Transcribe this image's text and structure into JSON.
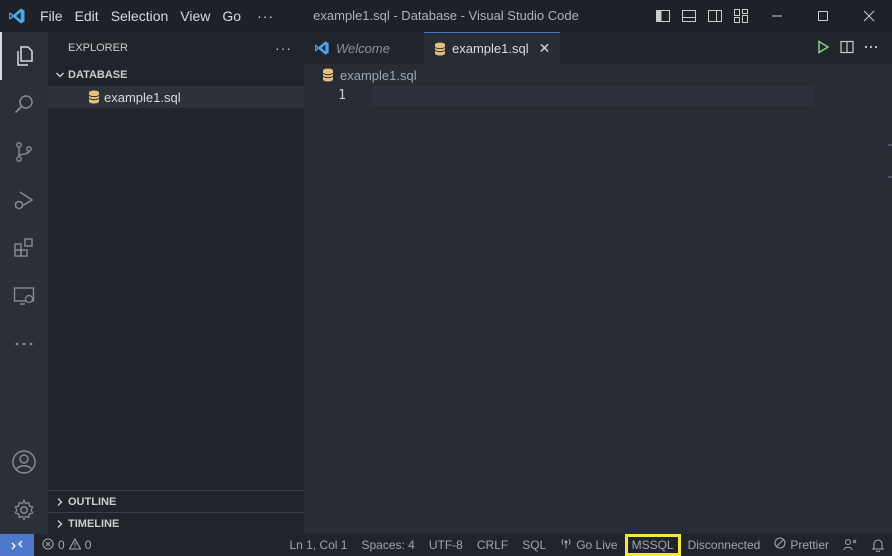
{
  "titlebar": {
    "menu": [
      "File",
      "Edit",
      "Selection",
      "View",
      "Go"
    ],
    "more": "···",
    "title": "example1.sql - Database - Visual Studio Code"
  },
  "sidebar": {
    "header": "EXPLORER",
    "more": "···",
    "folder": "DATABASE",
    "files": [
      {
        "name": "example1.sql",
        "icon": "database-icon"
      }
    ],
    "outline": "OUTLINE",
    "timeline": "TIMELINE"
  },
  "tabs": [
    {
      "label": "Welcome",
      "icon": "vscode-icon",
      "active": false
    },
    {
      "label": "example1.sql",
      "icon": "database-icon",
      "active": true,
      "close": "✕"
    }
  ],
  "editor": {
    "breadcrumb": "example1.sql",
    "line_numbers": [
      "1"
    ]
  },
  "statusbar": {
    "errors": "0",
    "warnings": "0",
    "position": "Ln 1, Col 1",
    "spaces": "Spaces: 4",
    "encoding": "UTF-8",
    "eol": "CRLF",
    "language": "SQL",
    "golive": "Go Live",
    "mssql": "MSSQL",
    "connection": "Disconnected",
    "prettier": "Prettier"
  },
  "colors": {
    "accent": "#4d78cc",
    "highlight": "#f5e642",
    "db_icon": "#e5c07b",
    "run": "#89d185"
  }
}
